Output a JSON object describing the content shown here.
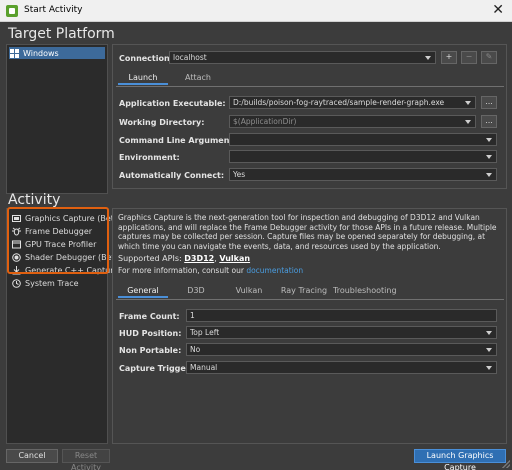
{
  "window": {
    "title": "Start Activity",
    "close_glyph": "✕"
  },
  "target_platform": {
    "heading": "Target Platform",
    "items": [
      {
        "label": "Windows",
        "icon": "windows-icon"
      }
    ]
  },
  "connection": {
    "label": "Connection:",
    "value": "localhost",
    "add": "+",
    "remove": "−",
    "edit": "✎"
  },
  "launch_tabs": [
    "Launch",
    "Attach"
  ],
  "launch_fields": {
    "executable": {
      "label": "Application Executable:",
      "value": "D:/builds/poison-fog-raytraced/sample-render-graph.exe"
    },
    "working_dir": {
      "label": "Working Directory:",
      "placeholder": "$(ApplicationDir)"
    },
    "args": {
      "label": "Command Line Arguments:",
      "value": ""
    },
    "env": {
      "label": "Environment:",
      "value": ""
    },
    "auto_connect": {
      "label": "Automatically Connect:",
      "value": "Yes"
    },
    "browse": "..."
  },
  "activity": {
    "heading": "Activity",
    "items": [
      {
        "label": "Graphics Capture (Beta)",
        "icon": "capture-icon"
      },
      {
        "label": "Frame Debugger",
        "icon": "bug-icon"
      },
      {
        "label": "GPU Trace Profiler",
        "icon": "profiler-icon"
      },
      {
        "label": "Shader Debugger (Beta)",
        "icon": "shader-icon"
      },
      {
        "label": "Generate C++ Capture",
        "icon": "download-icon"
      },
      {
        "label": "System Trace",
        "icon": "clock-icon"
      }
    ]
  },
  "description": {
    "paragraph": "Graphics Capture is the next-generation tool for inspection and debugging of D3D12 and Vulkan applications, and will replace the Frame Debugger activity for those APIs in a future release. Multiple captures may be collected per session. Capture files may be opened separately for debugging, at which time you can navigate the events, data, and resources used by the application.",
    "apis_prefix": "Supported APIs: ",
    "api1": "D3D12",
    "api_sep": ", ",
    "api2": "Vulkan",
    "more_prefix": "For more information, consult our ",
    "more_link": "documentation"
  },
  "settings_tabs": [
    "General",
    "D3D",
    "Vulkan",
    "Ray Tracing",
    "Troubleshooting"
  ],
  "settings": {
    "frame_count": {
      "label": "Frame Count:",
      "value": "1"
    },
    "hud_position": {
      "label": "HUD Position:",
      "value": "Top Left"
    },
    "non_portable": {
      "label": "Non Portable:",
      "value": "No"
    },
    "capture_trigger": {
      "label": "Capture Trigger:",
      "value": "Manual"
    }
  },
  "footer": {
    "cancel": "Cancel",
    "reset": "Reset Activity",
    "launch": "Launch Graphics Capture"
  },
  "colors": {
    "accent": "#2f6fb3",
    "highlight": "#e06010",
    "selection": "#3d6a9a",
    "link": "#4a9de0"
  }
}
